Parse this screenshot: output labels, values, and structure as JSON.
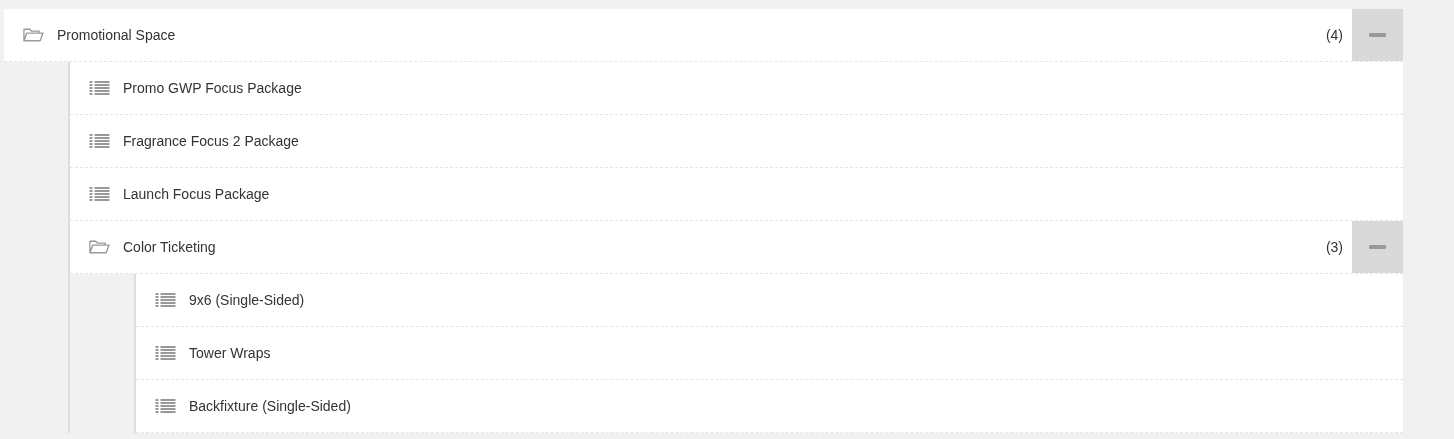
{
  "tree": [
    {
      "kind": "folder",
      "label": "Promotional Space",
      "count": "(4)",
      "expanded": true,
      "children": [
        {
          "kind": "leaf",
          "label": "Promo GWP Focus Package"
        },
        {
          "kind": "leaf",
          "label": "Fragrance Focus 2 Package"
        },
        {
          "kind": "leaf",
          "label": "Launch Focus Package"
        },
        {
          "kind": "folder",
          "label": "Color Ticketing",
          "count": "(3)",
          "expanded": true,
          "children": [
            {
              "kind": "leaf",
              "label": "9x6 (Single-Sided)"
            },
            {
              "kind": "leaf",
              "label": "Tower Wraps"
            },
            {
              "kind": "leaf",
              "label": "Backfixture (Single-Sided)"
            }
          ]
        }
      ]
    }
  ]
}
